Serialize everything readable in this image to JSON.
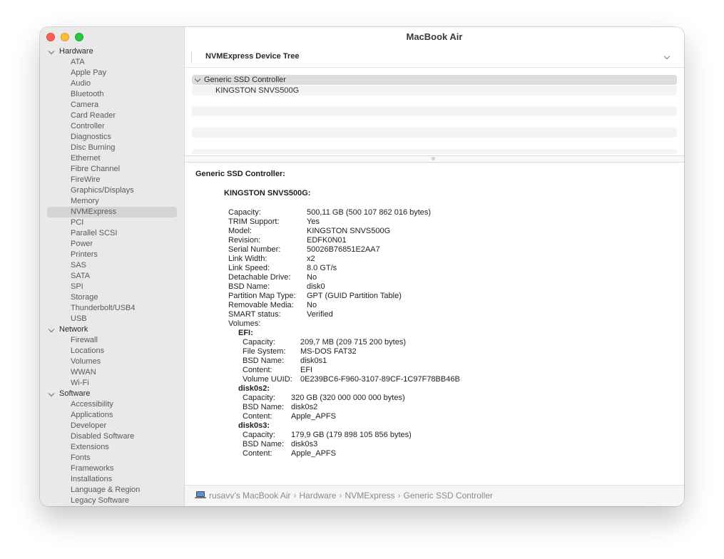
{
  "window": {
    "title": "MacBook Air"
  },
  "sidebar": {
    "sections": [
      {
        "label": "Hardware",
        "items": [
          "ATA",
          "Apple Pay",
          "Audio",
          "Bluetooth",
          "Camera",
          "Card Reader",
          "Controller",
          "Diagnostics",
          "Disc Burning",
          "Ethernet",
          "Fibre Channel",
          "FireWire",
          "Graphics/Displays",
          "Memory",
          "NVMExpress",
          "PCI",
          "Parallel SCSI",
          "Power",
          "Printers",
          "SAS",
          "SATA",
          "SPI",
          "Storage",
          "Thunderbolt/USB4",
          "USB"
        ]
      },
      {
        "label": "Network",
        "items": [
          "Firewall",
          "Locations",
          "Volumes",
          "WWAN",
          "Wi-Fi"
        ]
      },
      {
        "label": "Software",
        "items": [
          "Accessibility",
          "Applications",
          "Developer",
          "Disabled Software",
          "Extensions",
          "Fonts",
          "Frameworks",
          "Installations",
          "Language & Region",
          "Legacy Software"
        ]
      }
    ],
    "selected": "NVMExpress"
  },
  "list": {
    "header": "NVMExpress Device Tree",
    "rows": {
      "controller": "Generic SSD Controller",
      "device": "KINGSTON SNVS500G"
    }
  },
  "detail": {
    "controller_title": "Generic SSD Controller:",
    "device_title": "KINGSTON SNVS500G:",
    "fields": [
      {
        "key": "Capacity:",
        "value": "500,11 GB (500 107 862 016 bytes)"
      },
      {
        "key": "TRIM Support:",
        "value": "Yes"
      },
      {
        "key": "Model:",
        "value": "KINGSTON SNVS500G"
      },
      {
        "key": "Revision:",
        "value": "EDFK0N01"
      },
      {
        "key": "Serial Number:",
        "value": "50026B76851E2AA7"
      },
      {
        "key": "Link Width:",
        "value": "x2"
      },
      {
        "key": "Link Speed:",
        "value": "8.0 GT/s"
      },
      {
        "key": "Detachable Drive:",
        "value": "No"
      },
      {
        "key": "BSD Name:",
        "value": "disk0"
      },
      {
        "key": "Partition Map Type:",
        "value": "GPT (GUID Partition Table)"
      },
      {
        "key": "Removable Media:",
        "value": "No"
      },
      {
        "key": "SMART status:",
        "value": "Verified"
      }
    ],
    "volumes_label": "Volumes:",
    "volumes": [
      {
        "name": "EFI:",
        "fields": [
          {
            "key": "Capacity:",
            "value": "209,7 MB (209 715 200 bytes)"
          },
          {
            "key": "File System:",
            "value": "MS-DOS FAT32"
          },
          {
            "key": "BSD Name:",
            "value": "disk0s1"
          },
          {
            "key": "Content:",
            "value": "EFI"
          },
          {
            "key": "Volume UUID:",
            "value": "0E239BC6-F960-3107-89CF-1C97F78BB46B"
          }
        ]
      },
      {
        "name": "disk0s2:",
        "fields": [
          {
            "key": "Capacity:",
            "value": "320 GB (320 000 000 000 bytes)"
          },
          {
            "key": "BSD Name:",
            "value": "disk0s2"
          },
          {
            "key": "Content:",
            "value": "Apple_APFS"
          }
        ]
      },
      {
        "name": "disk0s3:",
        "fields": [
          {
            "key": "Capacity:",
            "value": "179,9 GB (179 898 105 856 bytes)"
          },
          {
            "key": "BSD Name:",
            "value": "disk0s3"
          },
          {
            "key": "Content:",
            "value": "Apple_APFS"
          }
        ]
      }
    ]
  },
  "pathbar": {
    "crumbs": [
      "rusavv’s MacBook Air",
      "Hardware",
      "NVMExpress",
      "Generic SSD Controller"
    ],
    "separator": "›"
  }
}
